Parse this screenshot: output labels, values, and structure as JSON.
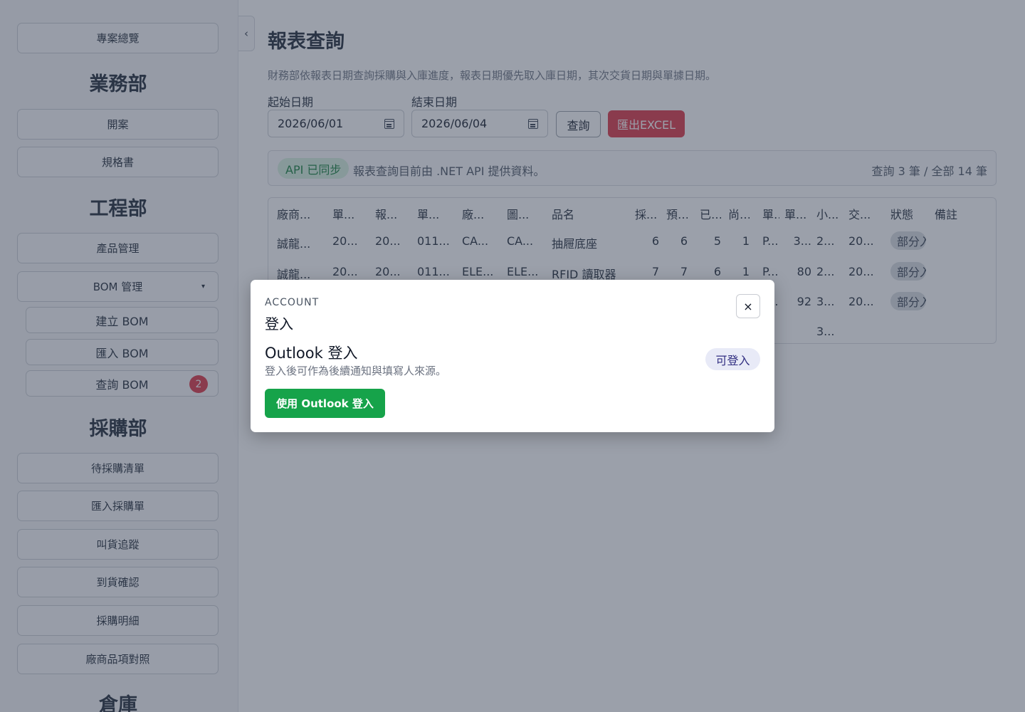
{
  "sidebar": {
    "top_button": "專案總覽",
    "sections": [
      {
        "title": "業務部",
        "items": [
          "開案",
          "規格書"
        ]
      },
      {
        "title": "工程部",
        "items": [
          "產品管理"
        ],
        "bom": {
          "label": "BOM 管理",
          "caret": "▾",
          "sub": [
            {
              "label": "建立 BOM"
            },
            {
              "label": "匯入 BOM"
            },
            {
              "label": "查詢 BOM",
              "badge": "2"
            }
          ]
        }
      },
      {
        "title": "採購部",
        "items": [
          "待採購清單",
          "匯入採購單",
          "叫貨追蹤",
          "到貨確認",
          "採購明細",
          "廠商品項對照"
        ]
      },
      {
        "title": "倉庫"
      }
    ],
    "collapse_glyph": "‹"
  },
  "main": {
    "title": "報表查詢",
    "description": "財務部依報表日期查詢採購與入庫進度，報表日期優先取入庫日期，其次交貨日期與單據日期。",
    "start_label": "起始日期",
    "start_value": "2026/06/01",
    "end_label": "結束日期",
    "end_value": "2026/06/04",
    "query_button": "查詢",
    "export_button": "匯出EXCEL",
    "status_pill": "API 已同步",
    "status_text": "報表查詢目前由 .NET API 提供資料。",
    "status_count": "查詢 3 筆 / 全部 14 筆",
    "table": {
      "headers": [
        "廠商...",
        "單...",
        "報...",
        "單...",
        "廠...",
        "圖...",
        "品名",
        "採...",
        "預...",
        "已...",
        "尚...",
        "單...",
        "單...",
        "小...",
        "交...",
        "狀態",
        "備註"
      ],
      "rows": [
        [
          "誠龍...",
          "20...",
          "20...",
          "011...",
          "CA...",
          "CA...",
          "抽屜底座",
          "6",
          "6",
          "5",
          "1",
          "P...",
          "3...",
          "2...",
          "20...",
          "部分入庫",
          ""
        ],
        [
          "誠龍...",
          "20...",
          "20...",
          "011...",
          "ELE...",
          "ELE...",
          "RFID 讀取器",
          "7",
          "7",
          "6",
          "1",
          "P...",
          "80",
          "2...",
          "20...",
          "部分入庫",
          ""
        ],
        [
          "誠龍...",
          "20...",
          "20...",
          "011...",
          "ELE...",
          "ELE...",
          "...",
          "...",
          "...",
          "...",
          "...",
          "P...",
          "92",
          "3...",
          "20...",
          "部分入庫",
          ""
        ]
      ],
      "total_row": {
        "subtotal": "3..."
      }
    }
  },
  "modal": {
    "eyebrow": "ACCOUNT",
    "title": "登入",
    "close": "×",
    "provider_name": "Outlook 登入",
    "provider_desc": "登入後可作為後續通知與填寫人來源。",
    "provider_status": "可登入",
    "login_button": "使用 Outlook 登入"
  },
  "colors": {
    "export": "#dc3545",
    "login": "#16a34a",
    "sync_pill_bg": "#d7f0df",
    "badge": "#dc3545"
  }
}
